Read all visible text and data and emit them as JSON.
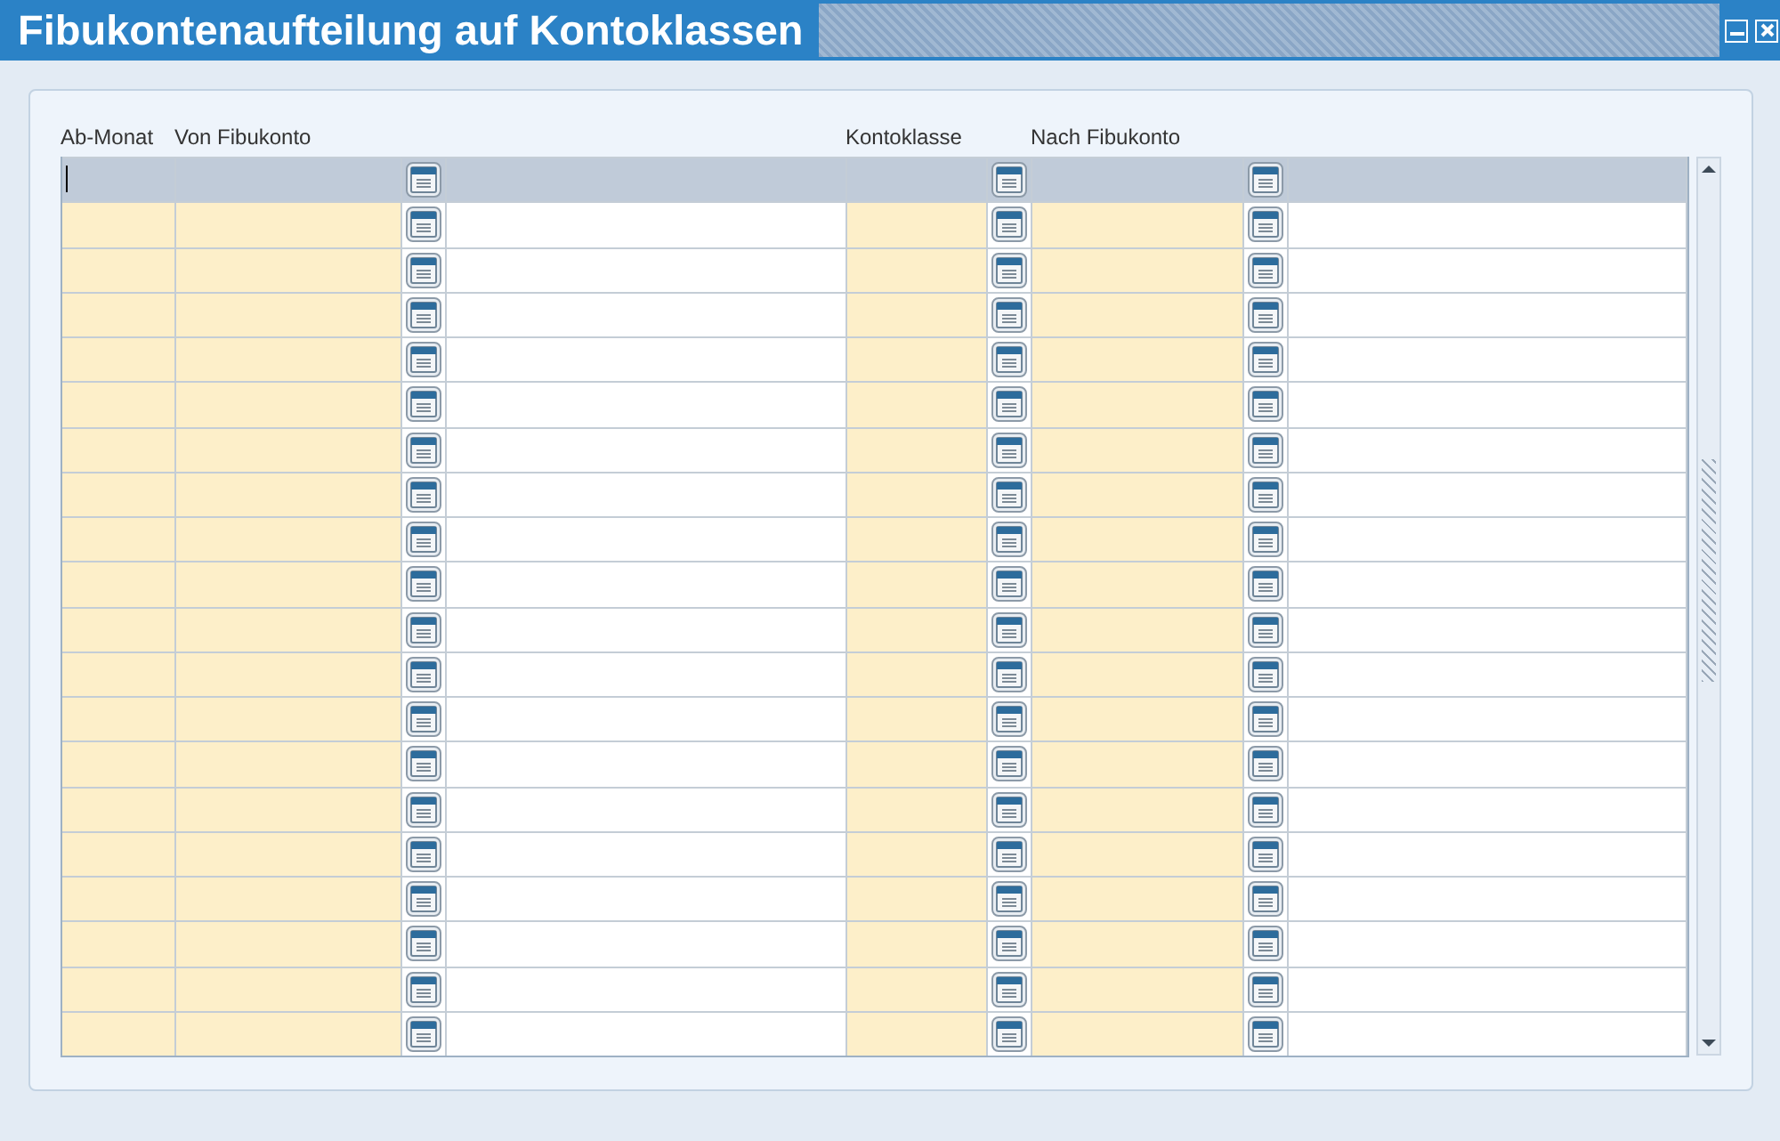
{
  "window": {
    "title": "Fibukontenaufteilung auf Kontoklassen"
  },
  "columns": [
    "Ab-Monat",
    "Von Fibukonto",
    "Kontoklasse",
    "Nach Fibukonto"
  ],
  "rows": [
    {
      "selected": true
    },
    {
      "selected": false
    },
    {
      "selected": false
    },
    {
      "selected": false
    },
    {
      "selected": false
    },
    {
      "selected": false
    },
    {
      "selected": false
    },
    {
      "selected": false
    },
    {
      "selected": false
    },
    {
      "selected": false
    },
    {
      "selected": false
    },
    {
      "selected": false
    },
    {
      "selected": false
    },
    {
      "selected": false
    },
    {
      "selected": false
    },
    {
      "selected": false
    },
    {
      "selected": false
    },
    {
      "selected": false
    },
    {
      "selected": false
    },
    {
      "selected": false
    }
  ]
}
